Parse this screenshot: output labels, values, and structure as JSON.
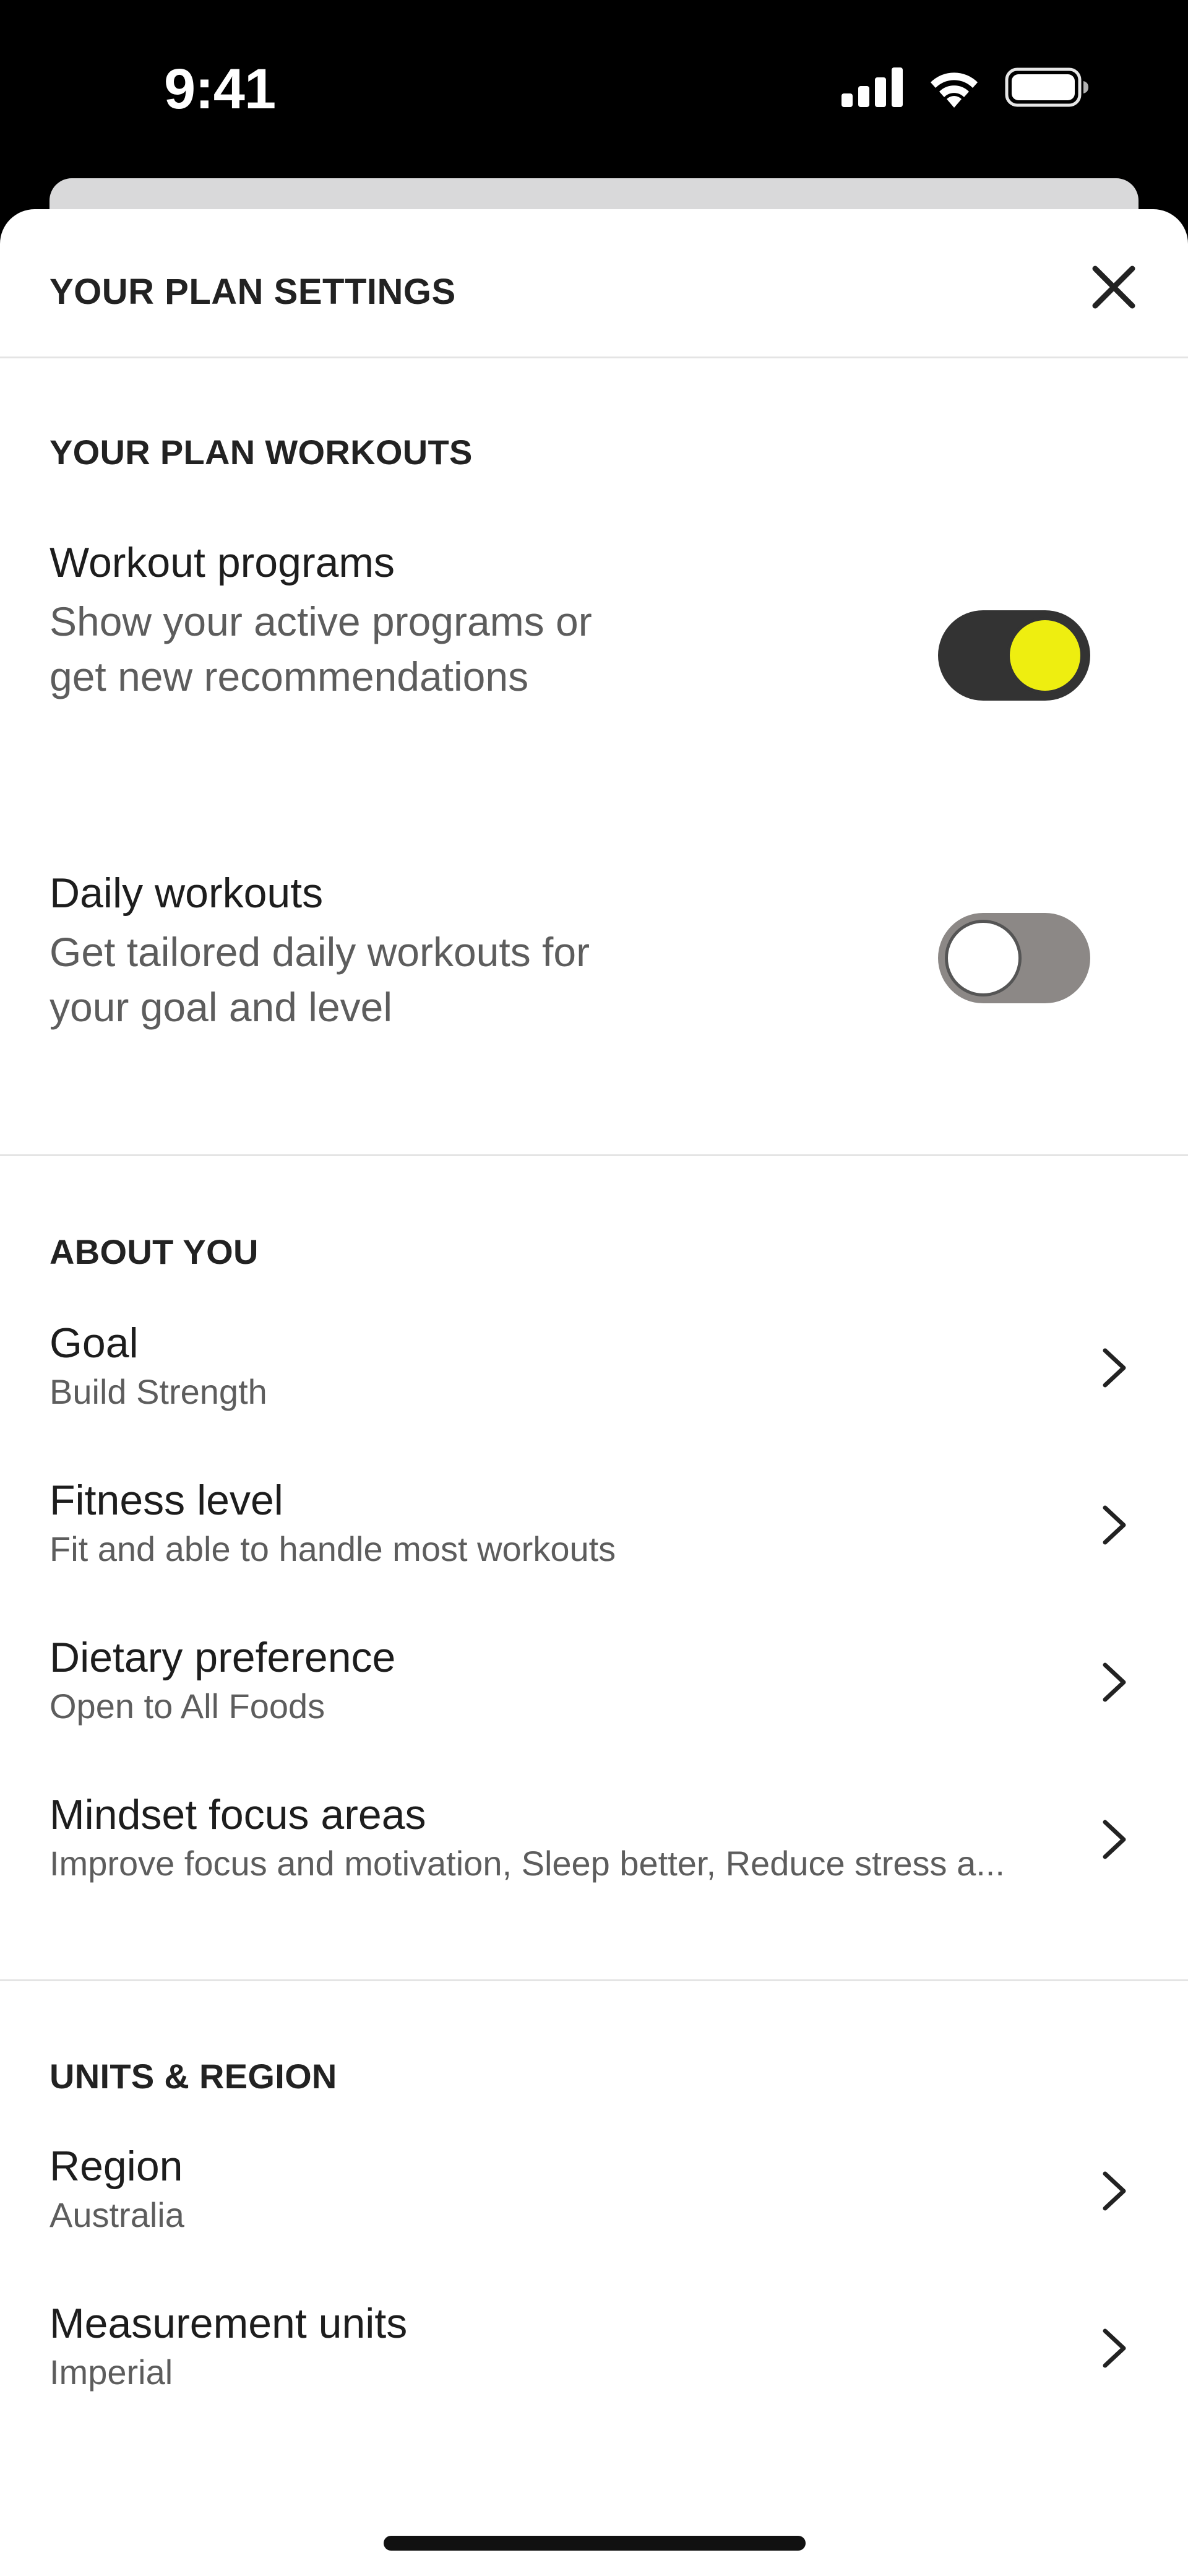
{
  "status_bar": {
    "time": "9:41"
  },
  "header": {
    "title": "YOUR PLAN SETTINGS"
  },
  "workouts_section": {
    "heading": "YOUR PLAN WORKOUTS",
    "items": [
      {
        "title": "Workout programs",
        "description": "Show your active programs or get new recommendations",
        "enabled": true
      },
      {
        "title": "Daily workouts",
        "description": "Get tailored daily workouts for your goal and level",
        "enabled": false
      }
    ]
  },
  "about_section": {
    "heading": "ABOUT YOU",
    "items": [
      {
        "title": "Goal",
        "value": "Build Strength"
      },
      {
        "title": "Fitness level",
        "value": "Fit and able to handle most workouts"
      },
      {
        "title": "Dietary preference",
        "value": "Open to All Foods"
      },
      {
        "title": "Mindset focus areas",
        "value": "Improve focus and motivation, Sleep better, Reduce stress a..."
      }
    ]
  },
  "units_section": {
    "heading": "UNITS & REGION",
    "items": [
      {
        "title": "Region",
        "value": "Australia"
      },
      {
        "title": "Measurement units",
        "value": "Imperial"
      }
    ]
  },
  "colors": {
    "toggle_on_track": "#333333",
    "toggle_on_knob": "#eeee10",
    "toggle_off_track": "#8c8886",
    "sheet_background": "#ffffff",
    "screen_background": "#000000"
  },
  "icons": {
    "close": "close-icon",
    "chevron": "chevron-right-icon",
    "signal": "cellular-signal-icon",
    "wifi": "wifi-icon",
    "battery": "battery-icon"
  }
}
